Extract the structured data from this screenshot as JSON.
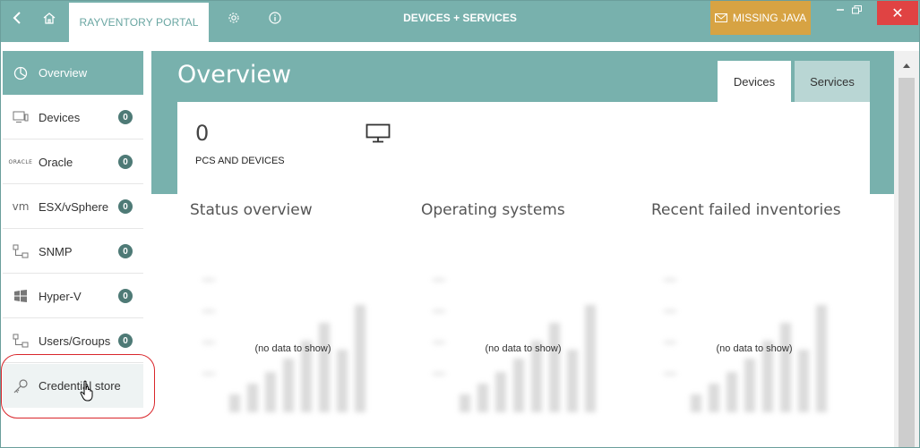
{
  "titlebar": {
    "portal_tab": "RAYVENTORY PORTAL",
    "center_title": "DEVICES + SERVICES",
    "missing_java": "MISSING JAVA",
    "close_glyph": "✕"
  },
  "sidebar": {
    "items": [
      {
        "label": "Overview",
        "icon": "overview-icon"
      },
      {
        "label": "Devices",
        "count": "0",
        "icon": "devices-icon"
      },
      {
        "label": "Oracle",
        "count": "0",
        "icon": "oracle-logo",
        "logo_text": "ORACLE"
      },
      {
        "label": "ESX/vSphere",
        "count": "0",
        "icon": "vm-logo",
        "logo_text": "vm"
      },
      {
        "label": "SNMP",
        "count": "0",
        "icon": "snmp-icon"
      },
      {
        "label": "Hyper-V",
        "count": "0",
        "icon": "windows-icon"
      },
      {
        "label": "Users/Groups",
        "count": "0",
        "icon": "users-groups-icon"
      },
      {
        "label": "Credential store",
        "icon": "key-icon"
      }
    ]
  },
  "main": {
    "title": "Overview",
    "tabs": [
      "Devices",
      "Services"
    ],
    "pcs_count": "0",
    "pcs_label": "PCS AND DEVICES",
    "sections": [
      {
        "title": "Status overview",
        "empty": "(no data to show)"
      },
      {
        "title": "Operating systems",
        "empty": "(no data to show)"
      },
      {
        "title": "Recent failed inventories",
        "empty": "(no data to show)"
      }
    ]
  },
  "colors": {
    "accent": "#78b1ad",
    "badge": "#4e7a76",
    "warning": "#d7a343",
    "close": "#e04343",
    "highlight_ring": "#d9262b"
  }
}
